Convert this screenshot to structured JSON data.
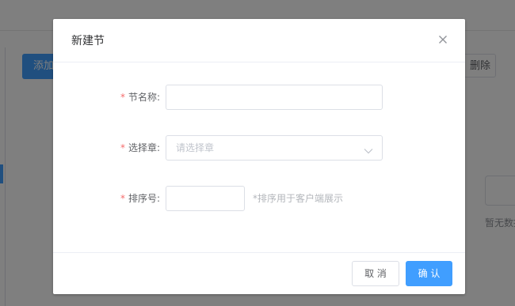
{
  "background": {
    "add_button_label": "添加",
    "delete_button_label": "删除",
    "empty_text": "暂无数据"
  },
  "dialog": {
    "title": "新建节",
    "close_icon": "close-icon",
    "fields": {
      "section_name": {
        "required_mark": "*",
        "label": "节名称:",
        "value": "",
        "placeholder": ""
      },
      "chapter": {
        "required_mark": "*",
        "label": "选择章:",
        "placeholder": "请选择章",
        "icon": "chevron-down-icon"
      },
      "order": {
        "required_mark": "*",
        "label": "排序号:",
        "value": "",
        "hint": "*排序用于客户端展示"
      }
    },
    "buttons": {
      "cancel": "取 消",
      "confirm": "确 认"
    }
  },
  "colors": {
    "primary": "#409eff",
    "required": "#f56c6c",
    "overlay": "rgba(0,0,0,0.5)"
  }
}
